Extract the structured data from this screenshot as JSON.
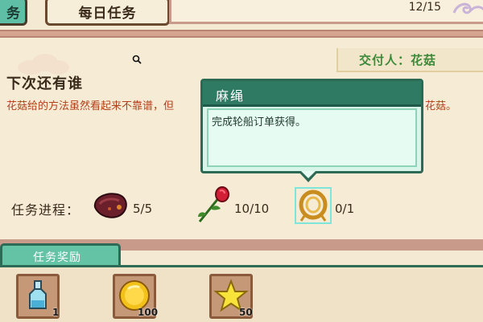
{
  "tabs": {
    "left_partial": "务",
    "daily": "每日任务"
  },
  "progress_count": "12/15",
  "giver": "交付人：花菇",
  "quest": {
    "title": "下次还有谁",
    "description_start": "花菇给的方法虽然看起来不靠谱，但",
    "description_end": "花菇。"
  },
  "tooltip": {
    "title": "麻绳",
    "text": "完成轮船订单获得。"
  },
  "progress": {
    "label": "任务进程：",
    "items": [
      {
        "icon": "meat-icon",
        "count": "5/5"
      },
      {
        "icon": "red-flower-icon",
        "count": "10/10"
      },
      {
        "icon": "rope-icon",
        "count": "0/1"
      }
    ]
  },
  "rewards": {
    "tab_label": "任务奖励",
    "items": [
      {
        "icon": "potion-icon",
        "count": "1"
      },
      {
        "icon": "gold-coin-icon",
        "count": "100"
      },
      {
        "icon": "star-icon",
        "count": "50"
      }
    ]
  },
  "colors": {
    "accent_green": "#2f7a62",
    "tab_teal": "#5fbfa6",
    "quest_text_red": "#b2401a",
    "giver_green": "#3d8a3a"
  }
}
